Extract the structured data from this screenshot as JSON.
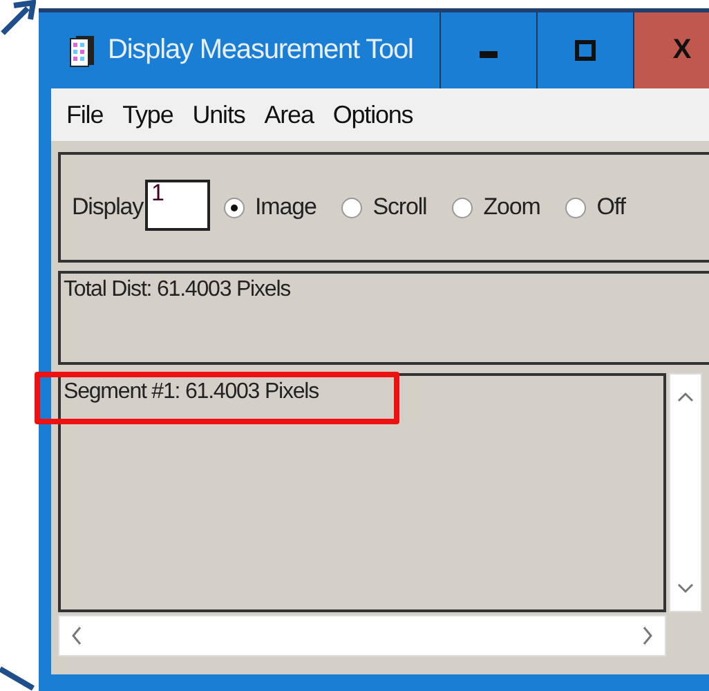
{
  "window": {
    "title": "Display Measurement Tool",
    "controls": [
      {
        "kind": "minimize"
      },
      {
        "kind": "maximize"
      },
      {
        "kind": "close",
        "label": "X"
      }
    ]
  },
  "menu": [
    "File",
    "Type",
    "Units",
    "Area",
    "Options"
  ],
  "display": {
    "label": "Display",
    "value": "1"
  },
  "radios": [
    {
      "label": "Image",
      "selected": true
    },
    {
      "label": "Scroll",
      "selected": false
    },
    {
      "label": "Zoom",
      "selected": false
    },
    {
      "label": "Off",
      "selected": false
    }
  ],
  "total_dist": "Total Dist: 61.4003 Pixels",
  "segments": [
    {
      "text": "Segment #1: 61.4003 Pixels",
      "highlighted": true
    }
  ]
}
